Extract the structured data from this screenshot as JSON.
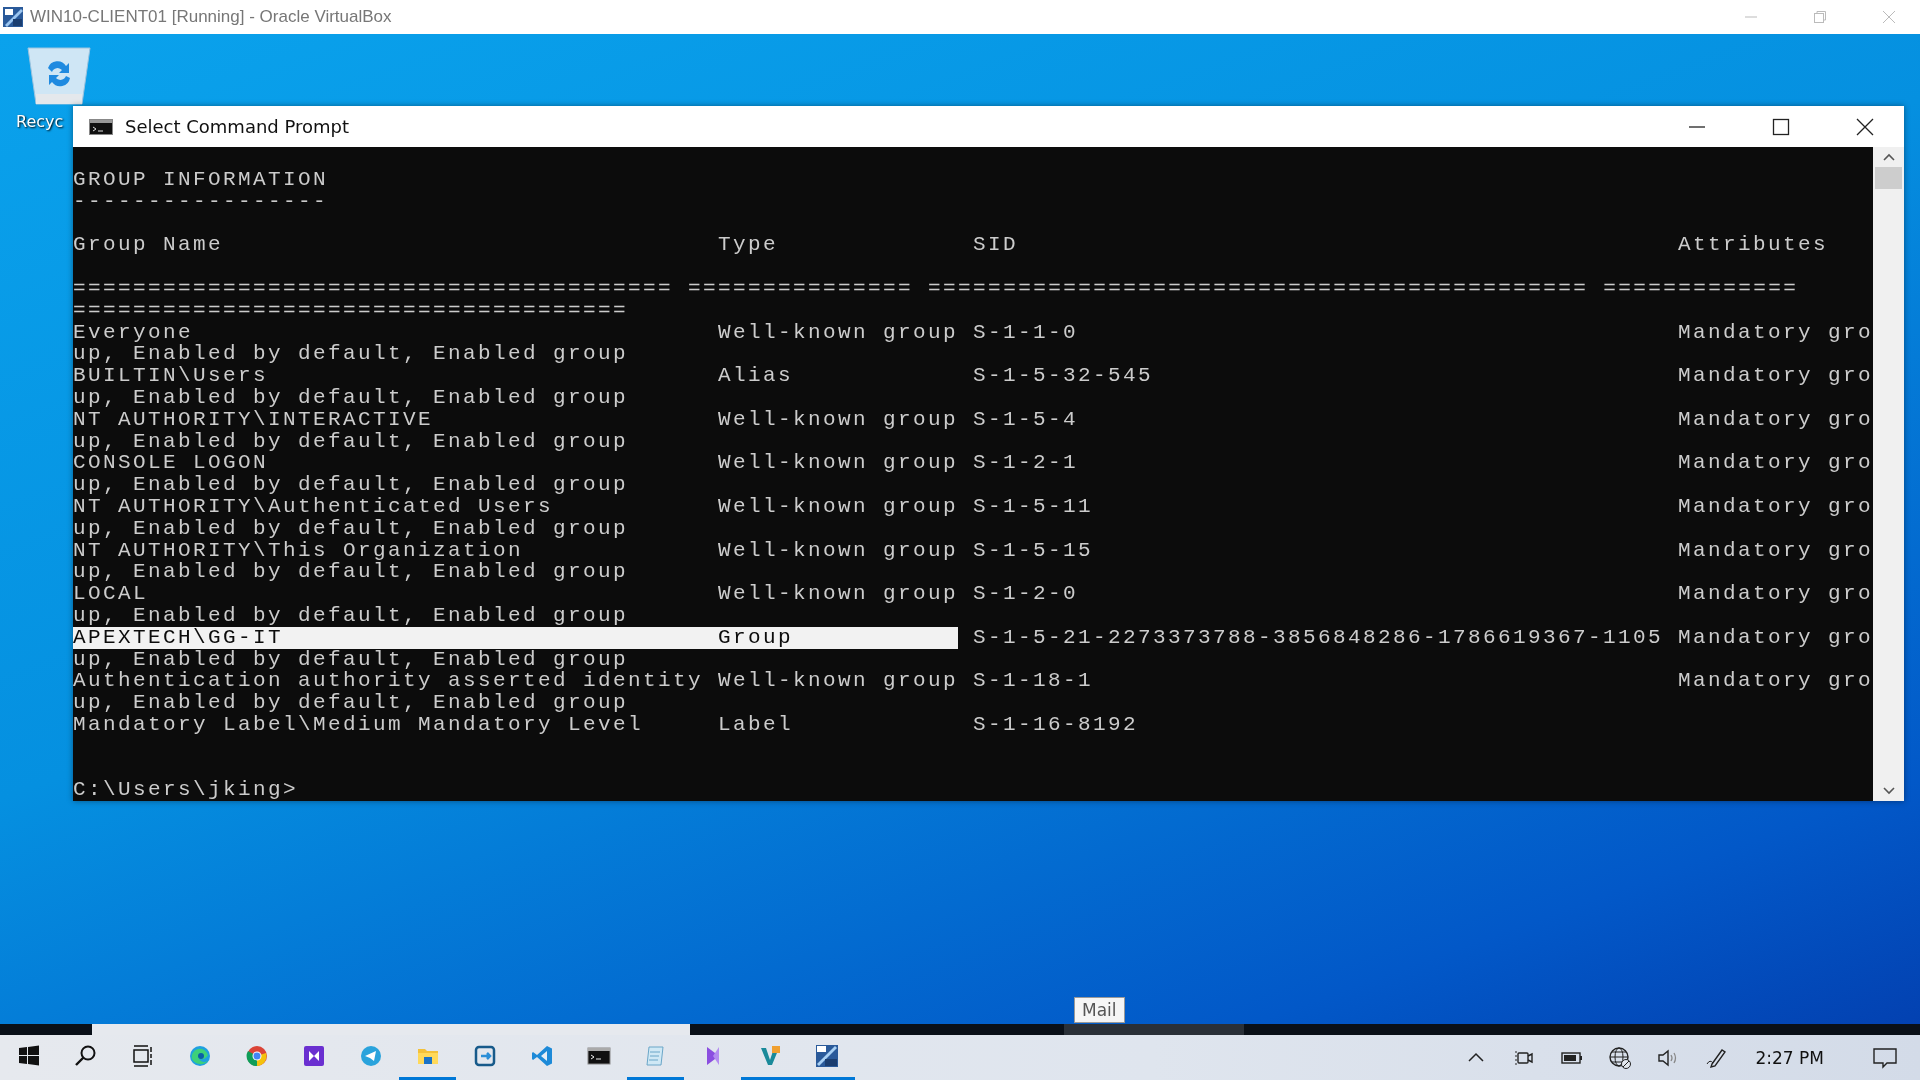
{
  "host_window": {
    "title": "WIN10-CLIENT01 [Running] - Oracle VirtualBox"
  },
  "desktop_icons": [
    {
      "kind": "recycle-bin",
      "label": "Recyc"
    }
  ],
  "console_window": {
    "title": "Select Command Prompt",
    "heading": "GROUP INFORMATION",
    "heading_rule": "-----------------",
    "columns": [
      "Group Name",
      "Type",
      "SID",
      "Attributes"
    ],
    "rule_lines": [
      "======================================== =============== ============================================ =============",
      "====================================="
    ],
    "rows": [
      {
        "name": "Everyone",
        "type": "Well-known group",
        "sid": "S-1-1-0",
        "attributes": "Mandatory gro",
        "continuation": "up, Enabled by default, Enabled group",
        "selected": false
      },
      {
        "name": "BUILTIN\\Users",
        "type": "Alias",
        "sid": "S-1-5-32-545",
        "attributes": "Mandatory gro",
        "continuation": "up, Enabled by default, Enabled group",
        "selected": false
      },
      {
        "name": "NT AUTHORITY\\INTERACTIVE",
        "type": "Well-known group",
        "sid": "S-1-5-4",
        "attributes": "Mandatory gro",
        "continuation": "up, Enabled by default, Enabled group",
        "selected": false
      },
      {
        "name": "CONSOLE LOGON",
        "type": "Well-known group",
        "sid": "S-1-2-1",
        "attributes": "Mandatory gro",
        "continuation": "up, Enabled by default, Enabled group",
        "selected": false
      },
      {
        "name": "NT AUTHORITY\\Authenticated Users",
        "type": "Well-known group",
        "sid": "S-1-5-11",
        "attributes": "Mandatory gro",
        "continuation": "up, Enabled by default, Enabled group",
        "selected": false
      },
      {
        "name": "NT AUTHORITY\\This Organization",
        "type": "Well-known group",
        "sid": "S-1-5-15",
        "attributes": "Mandatory gro",
        "continuation": "up, Enabled by default, Enabled group",
        "selected": false
      },
      {
        "name": "LOCAL",
        "type": "Well-known group",
        "sid": "S-1-2-0",
        "attributes": "Mandatory gro",
        "continuation": "up, Enabled by default, Enabled group",
        "selected": false
      },
      {
        "name": "APEXTECH\\GG-IT",
        "type": "Group",
        "sid": "S-1-5-21-2273373788-3856848286-1786619367-1105",
        "attributes": "Mandatory gro",
        "continuation": "up, Enabled by default, Enabled group",
        "selected": true
      },
      {
        "name": "Authentication authority asserted identity",
        "type": "Well-known group",
        "sid": "S-1-18-1",
        "attributes": "Mandatory gro",
        "continuation": "up, Enabled by default, Enabled group",
        "selected": false
      },
      {
        "name": "Mandatory Label\\Medium Mandatory Level",
        "type": "Label",
        "sid": "S-1-16-8192",
        "selected": false
      }
    ],
    "prompt": "C:\\Users\\jking>"
  },
  "tooltip": {
    "text": "Mail"
  },
  "taskbar": {
    "apps": [
      {
        "kind": "start",
        "active": false
      },
      {
        "kind": "search",
        "active": false
      },
      {
        "kind": "task-view",
        "active": false
      },
      {
        "kind": "edge",
        "active": false
      },
      {
        "kind": "chrome",
        "active": false
      },
      {
        "kind": "purple-play",
        "active": false
      },
      {
        "kind": "telegram",
        "active": false
      },
      {
        "kind": "folder",
        "active": true
      },
      {
        "kind": "remote",
        "active": false
      },
      {
        "kind": "vscode",
        "active": false
      },
      {
        "kind": "terminal",
        "active": false
      },
      {
        "kind": "notepad",
        "active": true
      },
      {
        "kind": "vs",
        "active": false
      },
      {
        "kind": "vs-tool",
        "active": true
      },
      {
        "kind": "vbox",
        "active": true
      }
    ],
    "tray": [
      {
        "kind": "chevron"
      },
      {
        "kind": "camera"
      },
      {
        "kind": "battery"
      },
      {
        "kind": "globe"
      },
      {
        "kind": "volume"
      },
      {
        "kind": "pen"
      }
    ],
    "clock": "2:27 PM"
  }
}
